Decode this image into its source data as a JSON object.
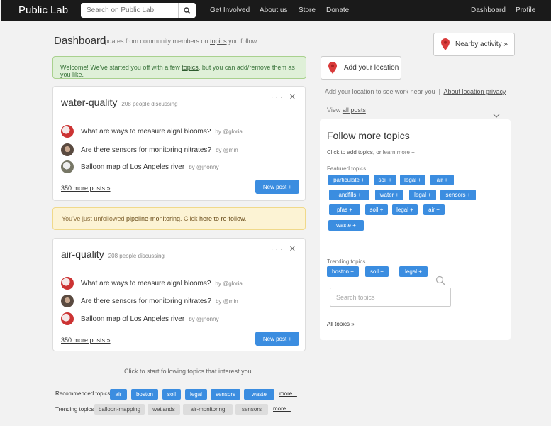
{
  "nav": {
    "brand": "Public Lab",
    "search_placeholder": "Search on Public Lab",
    "links": [
      "Get Involved",
      "About us",
      "Store",
      "Donate"
    ],
    "dashboard": "Dashboard",
    "profile": "Profile"
  },
  "header": {
    "title": "Dashboard",
    "subtitle_pre": "Updates from community members on ",
    "subtitle_link": "topics",
    "subtitle_post": " you follow",
    "nearby": "Nearby activity »"
  },
  "welcome": {
    "pre": "Welcome! We've started you off with a few ",
    "link": "topics",
    "post": ", but you can add/remove them as you like."
  },
  "cards": [
    {
      "title": "water-quality",
      "meta": "208 people discussing",
      "posts": [
        {
          "title": "What are ways to measure algal blooms?",
          "by": "by @gloria"
        },
        {
          "title": "Are there sensors for monitoring nitrates?",
          "by": "by @min"
        },
        {
          "title": "Balloon map of Los Angeles river",
          "by": "by @jhonny"
        }
      ],
      "more": "350 more posts »",
      "new_post": "New post +"
    },
    {
      "title": "air-quality",
      "meta": "208 people discussing",
      "posts": [
        {
          "title": "What are ways to measure algal blooms?",
          "by": "by @gloria"
        },
        {
          "title": "Are there sensors for monitoring nitrates?",
          "by": "by @min"
        },
        {
          "title": "Balloon map of Los Angeles river",
          "by": "by @jhonny"
        }
      ],
      "more": "350 more posts »",
      "new_post": "New post +"
    }
  ],
  "unfollow": {
    "pre": "You've just unfollowed ",
    "topic": "pipeline-monitoring",
    "mid": ". Click ",
    "link": "here to re-follow",
    "post": "."
  },
  "location": {
    "add": "Add your location",
    "note": "Add your location to see work near you",
    "sep": "|",
    "privacy": "About location privacy",
    "view_pre": "View ",
    "view_link": "all posts"
  },
  "follow": {
    "title": "Follow more topics",
    "sub_pre": "Click to add topics, or ",
    "sub_link": "learn more +",
    "featured_label": "Featured topics",
    "featured": [
      "particulate +",
      "soil +",
      "legal +",
      "air +",
      "landfills +",
      "water +",
      "legal +",
      "sensors +",
      "pfas +",
      "soil +",
      "legal +",
      "air +",
      "waste +"
    ],
    "trending_label": "Trending topics",
    "trending": [
      "boston +",
      "soil +",
      "legal +"
    ],
    "search_placeholder": "Search topics",
    "all_topics": "All topics »"
  },
  "bottom": {
    "prompt": "Click to start following topics that interest you",
    "recommended_label": "Recommended topics:",
    "recommended": [
      "air",
      "boston",
      "soil",
      "legal",
      "sensors",
      "waste"
    ],
    "recommended_more": "more...",
    "trending_label": "Trending topics:",
    "trending": [
      "balloon-mapping",
      "wetlands",
      "air-monitoring",
      "sensors"
    ],
    "trending_more": "more..."
  },
  "colors": {
    "nav_bg": "#1a1a1a",
    "primary": "#3b8de0",
    "success_bg": "#dff0d8",
    "warning_bg": "#fcf3d4",
    "pin": "#d93a3a"
  }
}
